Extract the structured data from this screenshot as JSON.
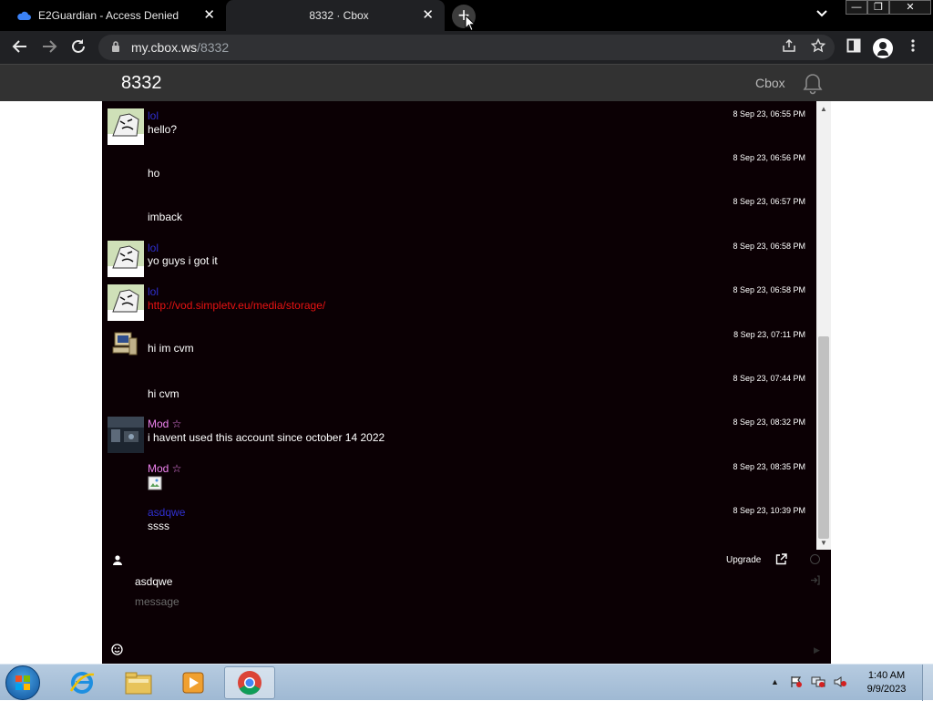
{
  "browser": {
    "tabs": [
      {
        "title": "E2Guardian - Access Denied",
        "active": false
      },
      {
        "title": "8332 · Cbox",
        "active": true
      }
    ],
    "url_host": "my.cbox.ws",
    "url_path": "/8332"
  },
  "site": {
    "title": "8332",
    "brand": "Cbox"
  },
  "messages": [
    {
      "author": "lol",
      "author_type": "user",
      "avatar": "meme",
      "text": "hello?",
      "time": "8 Sep 23, 06:55 PM"
    },
    {
      "author": "",
      "author_type": "none",
      "avatar": "",
      "text": "ho",
      "time": "8 Sep 23, 06:56 PM"
    },
    {
      "author": "",
      "author_type": "none",
      "avatar": "",
      "text": "imback",
      "time": "8 Sep 23, 06:57 PM"
    },
    {
      "author": "lol",
      "author_type": "user",
      "avatar": "meme",
      "text": "yo guys i got it",
      "time": "8 Sep 23, 06:58 PM"
    },
    {
      "author": "lol",
      "author_type": "user",
      "avatar": "meme",
      "text": "http://vod.simpletv.eu/media/storage/",
      "time": "8 Sep 23, 06:58 PM",
      "is_link": true
    },
    {
      "author": "",
      "author_type": "none",
      "avatar": "computer",
      "text": "hi im cvm",
      "time": "8 Sep 23, 07:11 PM"
    },
    {
      "author": "",
      "author_type": "none",
      "avatar": "",
      "text": "hi cvm",
      "time": "8 Sep 23, 07:44 PM"
    },
    {
      "author": "Mod ☆",
      "author_type": "mod",
      "avatar": "photo",
      "text": "i havent used this account since october 14 2022",
      "time": "8 Sep 23, 08:32 PM"
    },
    {
      "author": "Mod ☆",
      "author_type": "mod",
      "avatar": "",
      "text": "",
      "time": "8 Sep 23, 08:35 PM",
      "has_image": true
    },
    {
      "author": "asdqwe",
      "author_type": "user",
      "avatar": "",
      "text": "ssss",
      "time": "8 Sep 23, 10:39 PM"
    }
  ],
  "composer": {
    "upgrade_label": "Upgrade",
    "name_value": "asdqwe",
    "message_placeholder": "message"
  },
  "taskbar": {
    "time": "1:40 AM",
    "date": "9/9/2023"
  },
  "colors": {
    "chat_bg": "#0b0004",
    "header_bg": "#323232",
    "user_name": "#2f2fcf",
    "mod_name": "#ee82ee",
    "link": "#e81212"
  }
}
